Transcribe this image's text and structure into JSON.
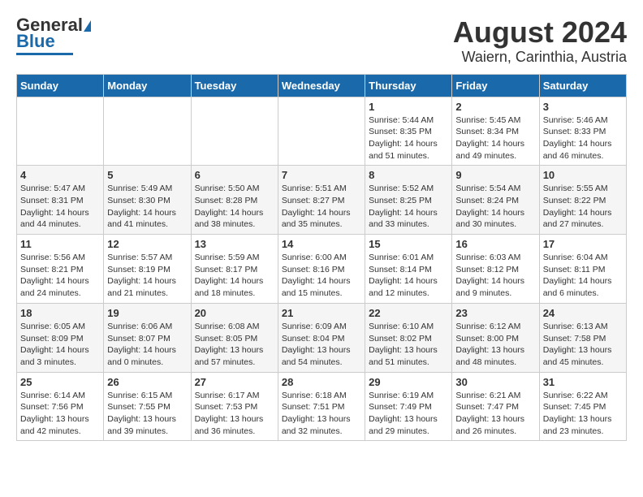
{
  "logo": {
    "line1": "General",
    "line2": "Blue"
  },
  "title": "August 2024",
  "subtitle": "Waiern, Carinthia, Austria",
  "days_of_week": [
    "Sunday",
    "Monday",
    "Tuesday",
    "Wednesday",
    "Thursday",
    "Friday",
    "Saturday"
  ],
  "weeks": [
    [
      {
        "day": "",
        "detail": ""
      },
      {
        "day": "",
        "detail": ""
      },
      {
        "day": "",
        "detail": ""
      },
      {
        "day": "",
        "detail": ""
      },
      {
        "day": "1",
        "detail": "Sunrise: 5:44 AM\nSunset: 8:35 PM\nDaylight: 14 hours\nand 51 minutes."
      },
      {
        "day": "2",
        "detail": "Sunrise: 5:45 AM\nSunset: 8:34 PM\nDaylight: 14 hours\nand 49 minutes."
      },
      {
        "day": "3",
        "detail": "Sunrise: 5:46 AM\nSunset: 8:33 PM\nDaylight: 14 hours\nand 46 minutes."
      }
    ],
    [
      {
        "day": "4",
        "detail": "Sunrise: 5:47 AM\nSunset: 8:31 PM\nDaylight: 14 hours\nand 44 minutes."
      },
      {
        "day": "5",
        "detail": "Sunrise: 5:49 AM\nSunset: 8:30 PM\nDaylight: 14 hours\nand 41 minutes."
      },
      {
        "day": "6",
        "detail": "Sunrise: 5:50 AM\nSunset: 8:28 PM\nDaylight: 14 hours\nand 38 minutes."
      },
      {
        "day": "7",
        "detail": "Sunrise: 5:51 AM\nSunset: 8:27 PM\nDaylight: 14 hours\nand 35 minutes."
      },
      {
        "day": "8",
        "detail": "Sunrise: 5:52 AM\nSunset: 8:25 PM\nDaylight: 14 hours\nand 33 minutes."
      },
      {
        "day": "9",
        "detail": "Sunrise: 5:54 AM\nSunset: 8:24 PM\nDaylight: 14 hours\nand 30 minutes."
      },
      {
        "day": "10",
        "detail": "Sunrise: 5:55 AM\nSunset: 8:22 PM\nDaylight: 14 hours\nand 27 minutes."
      }
    ],
    [
      {
        "day": "11",
        "detail": "Sunrise: 5:56 AM\nSunset: 8:21 PM\nDaylight: 14 hours\nand 24 minutes."
      },
      {
        "day": "12",
        "detail": "Sunrise: 5:57 AM\nSunset: 8:19 PM\nDaylight: 14 hours\nand 21 minutes."
      },
      {
        "day": "13",
        "detail": "Sunrise: 5:59 AM\nSunset: 8:17 PM\nDaylight: 14 hours\nand 18 minutes."
      },
      {
        "day": "14",
        "detail": "Sunrise: 6:00 AM\nSunset: 8:16 PM\nDaylight: 14 hours\nand 15 minutes."
      },
      {
        "day": "15",
        "detail": "Sunrise: 6:01 AM\nSunset: 8:14 PM\nDaylight: 14 hours\nand 12 minutes."
      },
      {
        "day": "16",
        "detail": "Sunrise: 6:03 AM\nSunset: 8:12 PM\nDaylight: 14 hours\nand 9 minutes."
      },
      {
        "day": "17",
        "detail": "Sunrise: 6:04 AM\nSunset: 8:11 PM\nDaylight: 14 hours\nand 6 minutes."
      }
    ],
    [
      {
        "day": "18",
        "detail": "Sunrise: 6:05 AM\nSunset: 8:09 PM\nDaylight: 14 hours\nand 3 minutes."
      },
      {
        "day": "19",
        "detail": "Sunrise: 6:06 AM\nSunset: 8:07 PM\nDaylight: 14 hours\nand 0 minutes."
      },
      {
        "day": "20",
        "detail": "Sunrise: 6:08 AM\nSunset: 8:05 PM\nDaylight: 13 hours\nand 57 minutes."
      },
      {
        "day": "21",
        "detail": "Sunrise: 6:09 AM\nSunset: 8:04 PM\nDaylight: 13 hours\nand 54 minutes."
      },
      {
        "day": "22",
        "detail": "Sunrise: 6:10 AM\nSunset: 8:02 PM\nDaylight: 13 hours\nand 51 minutes."
      },
      {
        "day": "23",
        "detail": "Sunrise: 6:12 AM\nSunset: 8:00 PM\nDaylight: 13 hours\nand 48 minutes."
      },
      {
        "day": "24",
        "detail": "Sunrise: 6:13 AM\nSunset: 7:58 PM\nDaylight: 13 hours\nand 45 minutes."
      }
    ],
    [
      {
        "day": "25",
        "detail": "Sunrise: 6:14 AM\nSunset: 7:56 PM\nDaylight: 13 hours\nand 42 minutes."
      },
      {
        "day": "26",
        "detail": "Sunrise: 6:15 AM\nSunset: 7:55 PM\nDaylight: 13 hours\nand 39 minutes."
      },
      {
        "day": "27",
        "detail": "Sunrise: 6:17 AM\nSunset: 7:53 PM\nDaylight: 13 hours\nand 36 minutes."
      },
      {
        "day": "28",
        "detail": "Sunrise: 6:18 AM\nSunset: 7:51 PM\nDaylight: 13 hours\nand 32 minutes."
      },
      {
        "day": "29",
        "detail": "Sunrise: 6:19 AM\nSunset: 7:49 PM\nDaylight: 13 hours\nand 29 minutes."
      },
      {
        "day": "30",
        "detail": "Sunrise: 6:21 AM\nSunset: 7:47 PM\nDaylight: 13 hours\nand 26 minutes."
      },
      {
        "day": "31",
        "detail": "Sunrise: 6:22 AM\nSunset: 7:45 PM\nDaylight: 13 hours\nand 23 minutes."
      }
    ]
  ]
}
